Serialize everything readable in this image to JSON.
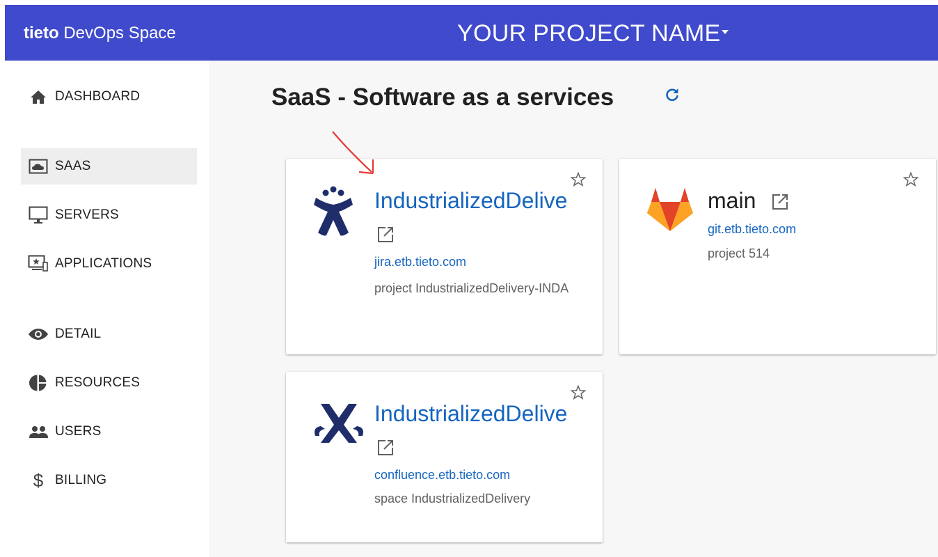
{
  "header": {
    "brand_bold": "tieto",
    "brand_rest": "DevOps Space",
    "project_name": "YOUR PROJECT NAME"
  },
  "nav": {
    "items": [
      {
        "label": "DASHBOARD",
        "icon": "home-icon"
      },
      {
        "label": "SAAS",
        "icon": "cloud-icon",
        "active": true
      },
      {
        "label": "SERVERS",
        "icon": "monitor-icon"
      },
      {
        "label": "APPLICATIONS",
        "icon": "applications-icon"
      },
      {
        "label": "DETAIL",
        "icon": "eye-icon"
      },
      {
        "label": "RESOURCES",
        "icon": "pie-chart-icon"
      },
      {
        "label": "USERS",
        "icon": "users-icon"
      },
      {
        "label": "BILLING",
        "icon": "dollar-icon"
      }
    ]
  },
  "main": {
    "title": "SaaS - Software as a services",
    "cards": [
      {
        "title": "IndustrializedDelive",
        "link": "jira.etb.tieto.com",
        "desc": "project IndustrializedDelivery-INDA",
        "logo": "jira-logo"
      },
      {
        "title": "main",
        "link": "git.etb.tieto.com",
        "desc": "project 514",
        "logo": "gitlab-logo"
      },
      {
        "title": "IndustrializedDelive",
        "link": "confluence.etb.tieto.com",
        "desc": "space IndustrializedDelivery",
        "logo": "confluence-logo"
      }
    ]
  },
  "colors": {
    "header_bg": "#3f4acc",
    "link": "#1565c0",
    "annotation_arrow": "#e53935",
    "gitlab_orange": "#fc6d26"
  }
}
